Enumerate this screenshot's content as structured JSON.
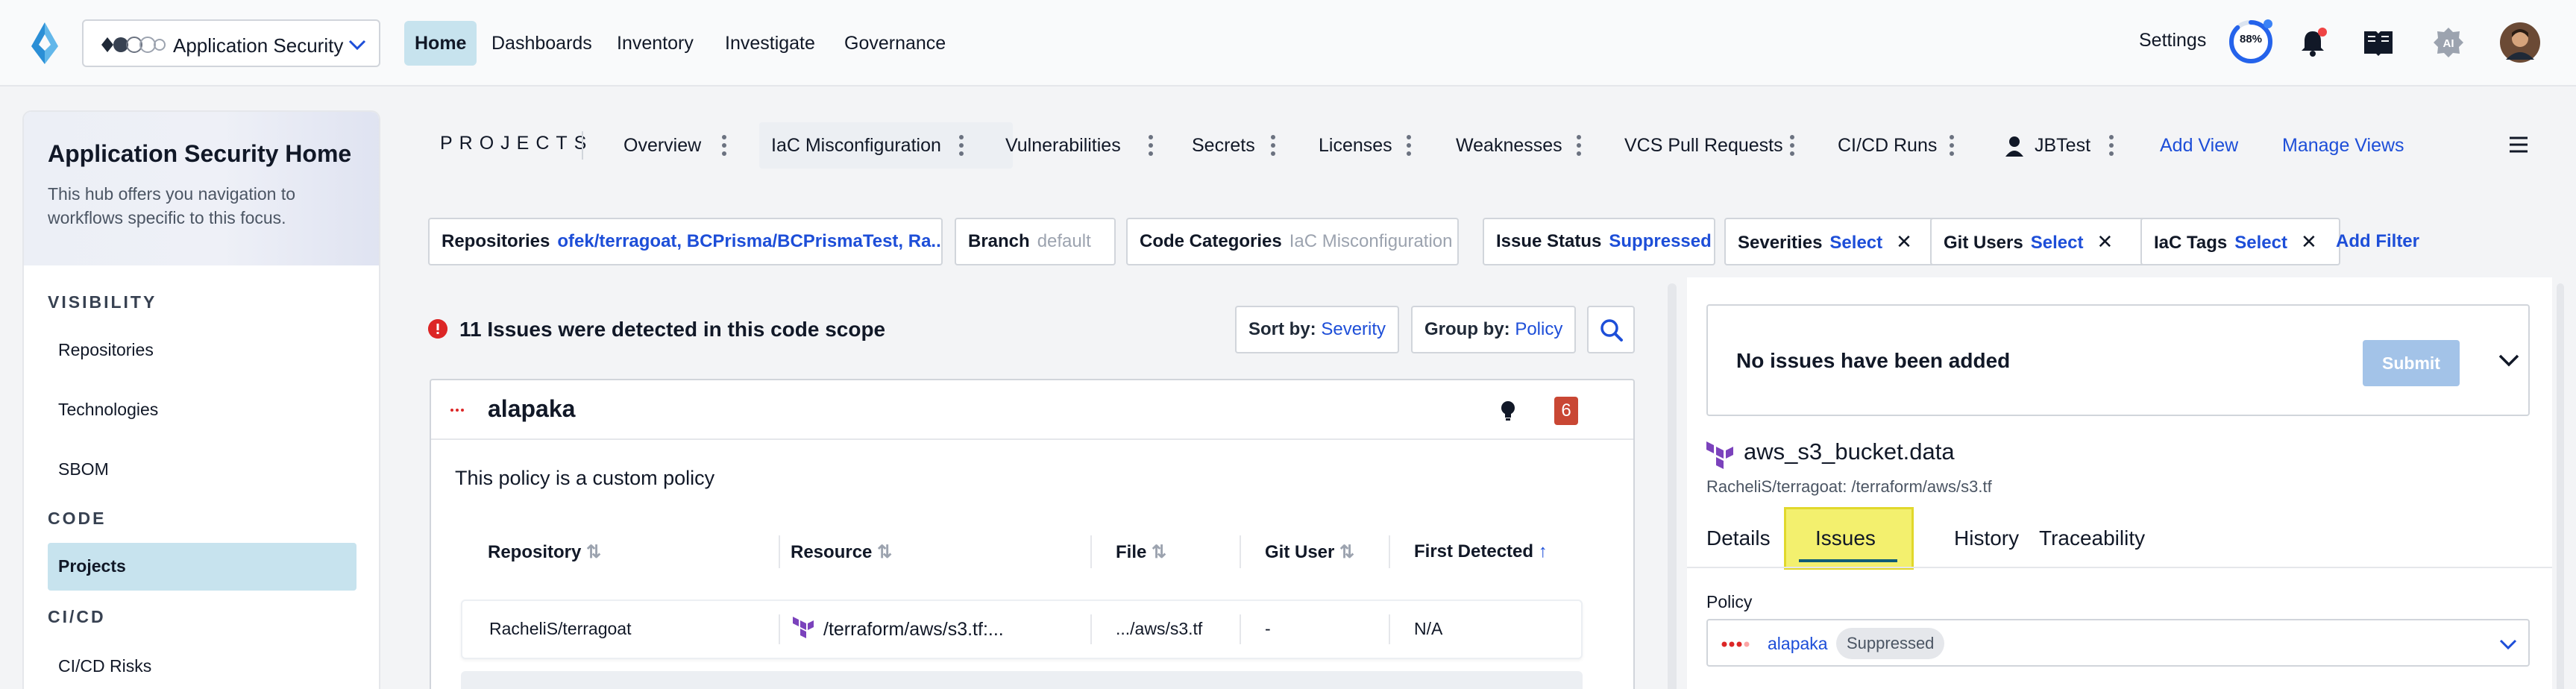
{
  "topbar": {
    "product_name": "Application Security",
    "nav": [
      {
        "label": "Home",
        "active": true
      },
      {
        "label": "Dashboards"
      },
      {
        "label": "Inventory"
      },
      {
        "label": "Investigate"
      },
      {
        "label": "Governance"
      }
    ],
    "settings_label": "Settings",
    "progress_text": "88%",
    "progress_value": 0.88,
    "ai_label": "AI",
    "icons": [
      "bell-icon",
      "book-icon",
      "ai-icon",
      "avatar"
    ]
  },
  "sidebar": {
    "title": "Application Security Home",
    "description": "This hub offers you navigation to workflows specific to this focus.",
    "sections": [
      {
        "heading": "VISIBILITY",
        "items": [
          "Repositories",
          "Technologies",
          "SBOM"
        ]
      },
      {
        "heading": "CODE",
        "items": [
          "Projects"
        ]
      },
      {
        "heading": "CI/CD",
        "items": [
          "CI/CD Risks"
        ]
      }
    ],
    "active_item": "Projects"
  },
  "projects_bar": {
    "label": "PROJECTS",
    "tabs": [
      {
        "label": "Overview"
      },
      {
        "label": "IaC Misconfiguration",
        "active": true
      },
      {
        "label": "Vulnerabilities"
      },
      {
        "label": "Secrets"
      },
      {
        "label": "Licenses"
      },
      {
        "label": "Weaknesses"
      },
      {
        "label": "VCS Pull Requests"
      },
      {
        "label": "CI/CD Runs"
      },
      {
        "label": "JBTest"
      }
    ],
    "add_view": "Add View",
    "manage_views": "Manage Views"
  },
  "filters": [
    {
      "label": "Repositories",
      "value": "ofek/terragoat, BCPrisma/BCPrismaTest, Ra..."
    },
    {
      "label": "Branch",
      "value": "default"
    },
    {
      "label": "Code Categories",
      "value": "IaC Misconfiguration"
    },
    {
      "label": "Issue Status",
      "value": "Suppressed"
    },
    {
      "label": "Severities",
      "value": "Select"
    },
    {
      "label": "Git Users",
      "value": "Select"
    },
    {
      "label": "IaC Tags",
      "value": "Select"
    }
  ],
  "add_filter": "Add Filter",
  "issues": {
    "summary": "11 Issues were detected in this code scope",
    "sort_label": "Sort by:",
    "sort_value": "Severity",
    "group_label": "Group by:",
    "group_value": "Policy",
    "card": {
      "policy_name": "alapaka",
      "count": "6",
      "description": "This policy is a custom policy",
      "columns": [
        "Repository",
        "Resource",
        "File",
        "Git User",
        "First Detected"
      ],
      "rows": [
        [
          "RacheliS/terragoat",
          "/terraform/aws/s3.tf:...",
          ".../aws/s3.tf",
          "-",
          "N/A"
        ]
      ]
    }
  },
  "details_panel": {
    "no_issues_text": "No issues have been added",
    "submit_label": "Submit",
    "resource_title": "aws_s3_bucket.data",
    "resource_path": "RacheliS/terragoat: /terraform/aws/s3.tf",
    "tabs": [
      "Details",
      "Issues",
      "History",
      "Traceability"
    ],
    "active_tab": "Issues",
    "policy_label": "Policy",
    "policy_value": "alapaka",
    "policy_status": "Suppressed"
  },
  "colors": {
    "accent": "#1d4ed8",
    "active_bg": "#c7e3ee",
    "highlight": "#f3f06e",
    "count_badge": "#c94734",
    "error": "#dc2626",
    "submit_disabled": "#a3c3e8"
  }
}
